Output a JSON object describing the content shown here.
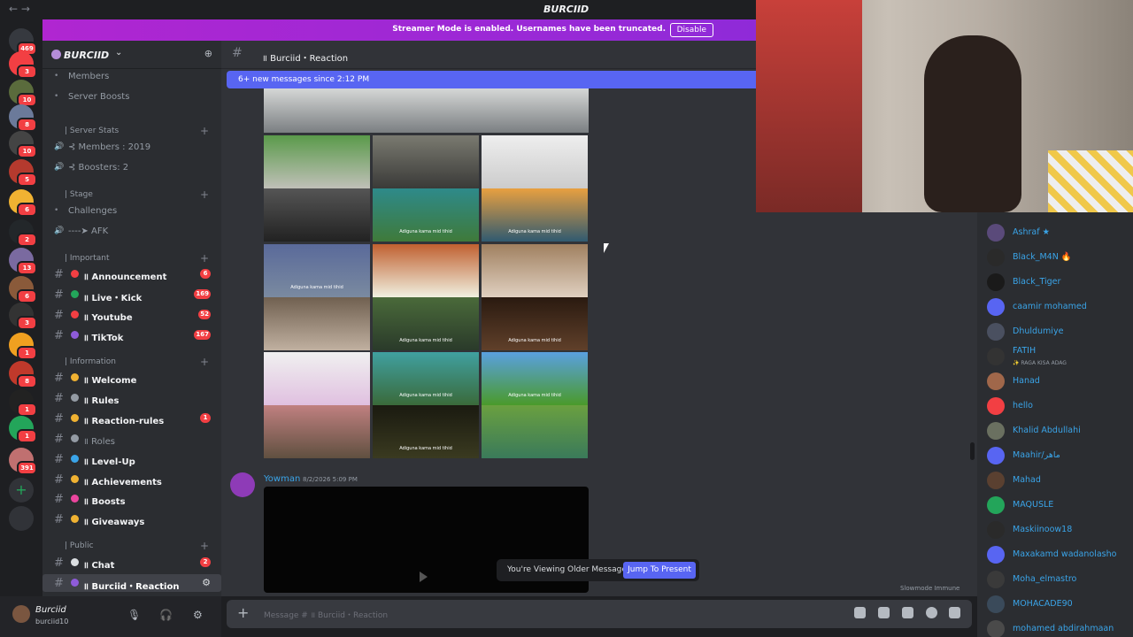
{
  "window": {
    "title": "BURCIID",
    "nav_label": "←  →"
  },
  "server_rail": {
    "badges": [
      "469",
      "3",
      "10",
      "8",
      "10",
      "5",
      "6",
      "2",
      "13",
      "6",
      "3",
      "1",
      "8",
      "1",
      "1",
      "391"
    ]
  },
  "streamer_banner": {
    "text": "Streamer Mode is enabled. Usernames have been truncated.",
    "button": "Disable"
  },
  "server": {
    "name": "BURCIID"
  },
  "channel_list": [
    {
      "type": "item",
      "label": "Members"
    },
    {
      "type": "item",
      "label": "Server Boosts"
    },
    {
      "type": "category",
      "label": "| Server Stats"
    },
    {
      "type": "voice",
      "label": "⊰ Members : 2019"
    },
    {
      "type": "voice",
      "label": "⊰ Boosters: 2"
    },
    {
      "type": "category",
      "label": "| Stage"
    },
    {
      "type": "item",
      "label": "Challenges"
    },
    {
      "type": "voice",
      "label": "----➤ AFK"
    },
    {
      "type": "category",
      "label": "| Important"
    },
    {
      "type": "channel",
      "label": "॥ Announcement",
      "badge": "6",
      "unread": true,
      "color": "#f23f43"
    },
    {
      "type": "channel",
      "label": "॥ Live・Kick",
      "badge": "169",
      "unread": true,
      "color": "#23a55a"
    },
    {
      "type": "channel",
      "label": "॥ Youtube",
      "badge": "52",
      "unread": true,
      "color": "#f23f43"
    },
    {
      "type": "channel",
      "label": "॥ TikTok",
      "badge": "167",
      "unread": true,
      "color": "#8e5bd9"
    },
    {
      "type": "category",
      "label": "| Information"
    },
    {
      "type": "channel",
      "label": "॥ Welcome",
      "unread": true,
      "color": "#f0b232"
    },
    {
      "type": "channel",
      "label": "॥ Rules",
      "unread": true,
      "color": "#949ba4"
    },
    {
      "type": "channel",
      "label": "॥ Reaction-rules",
      "badge": "1",
      "unread": true,
      "color": "#f0b232"
    },
    {
      "type": "channel",
      "label": "॥ Roles",
      "unread": false,
      "color": "#949ba4"
    },
    {
      "type": "channel",
      "label": "॥ Level-Up",
      "unread": true,
      "color": "#3aa4e8"
    },
    {
      "type": "channel",
      "label": "॥ Achievements",
      "unread": true,
      "color": "#f0b232"
    },
    {
      "type": "channel",
      "label": "॥ Boosts",
      "unread": true,
      "color": "#eb459e"
    },
    {
      "type": "channel",
      "label": "॥ Giveaways",
      "unread": true,
      "color": "#f0b232"
    },
    {
      "type": "category",
      "label": "| Public"
    },
    {
      "type": "channel",
      "label": "॥ Chat",
      "badge": "2",
      "unread": true,
      "color": "#dbdee1"
    },
    {
      "type": "channel",
      "label": "॥ Burciid・Reaction",
      "unread": true,
      "active": true,
      "color": "#8e5bd9"
    }
  ],
  "user_panel": {
    "name": "Burciid",
    "status": "burciid10"
  },
  "channel_header": {
    "title": "॥ Burciid・Reaction"
  },
  "new_messages_bar": "6+ new messages since 2:12 PM",
  "tile_caption": "Adiguna kama mid tihid",
  "tiles_with_caption": [
    4,
    5,
    6,
    10,
    11,
    13,
    14,
    16
  ],
  "message": {
    "author": "Yowman",
    "timestamp": "8/2/2026 5:09 PM"
  },
  "older_bar": {
    "text": "You're Viewing Older Messages",
    "button": "Jump To Present"
  },
  "slowmode": "Slowmode Immune",
  "composer": {
    "placeholder": "Message # ॥ Burciid・Reaction"
  },
  "members": [
    {
      "name": "Ashraf ★",
      "color": "#5a4a7a"
    },
    {
      "name": "Black_M4N 🔥",
      "color": "#2a2a2a"
    },
    {
      "name": "Black_Tiger",
      "color": "#1a1a1a"
    },
    {
      "name": "caamir mohamed",
      "color": "#5865f2"
    },
    {
      "name": "Dhuldumiye",
      "color": "#4a5060"
    },
    {
      "name": "FATIH",
      "sub": "✨ RAGA KISA ADAG",
      "color": "#333"
    },
    {
      "name": "Hanad",
      "color": "#a0674a"
    },
    {
      "name": "hello",
      "color": "#f23f43"
    },
    {
      "name": "Khalid Abdullahi",
      "color": "#6a7060"
    },
    {
      "name": "Maahir/ماهر",
      "color": "#5865f2"
    },
    {
      "name": "Mahad",
      "color": "#5a4030"
    },
    {
      "name": "MAQUSLE",
      "color": "#23a55a"
    },
    {
      "name": "Maskiinoow18",
      "color": "#2a2a2a"
    },
    {
      "name": "Maxakamd wadanolasho",
      "color": "#5865f2"
    },
    {
      "name": "Moha_elmastro",
      "color": "#3a3a3a"
    },
    {
      "name": "MOHACADE90",
      "color": "#3a4a5a"
    },
    {
      "name": "mohamed abdirahmaan",
      "color": "#4a4a4a"
    }
  ]
}
